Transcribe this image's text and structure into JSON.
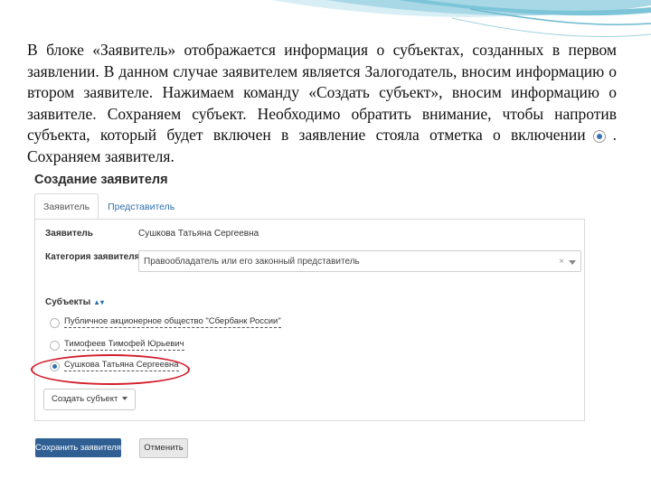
{
  "intro": {
    "text_before_icon": "В блоке «Заявитель» отображается информация о субъектах, созданных в первом заявлении. В данном случае заявителем является Залогодатель, вносим информацию о втором заявителе. Нажимаем команду «Создать субъект», вносим информацию о заявителе. Сохраняем субъект. Необходимо обратить внимание, чтобы напротив субъекта, который будет включен в заявление стояла отметка о включении",
    "text_after_icon": ". Сохраняем заявителя.",
    "icon": "radio-selected-icon"
  },
  "form": {
    "title": "Создание заявителя",
    "tabs": [
      {
        "label": "Заявитель",
        "active": true
      },
      {
        "label": "Представитель",
        "active": false
      }
    ],
    "applicant_label": "Заявитель",
    "applicant_value": "Сушкова Татьяна Сергеевна",
    "category_label": "Категория заявителя",
    "category_value": "Правообладатель или его законный представитель",
    "category_clear": "×",
    "subjects_label": "Субъекты",
    "subjects_sort": "▲▾",
    "subjects": [
      {
        "name": "Публичное акционерное общество \"Сбербанк России\"",
        "selected": false
      },
      {
        "name": "Тимофеев Тимофей Юрьевич",
        "selected": false
      },
      {
        "name": "Сушкова Татьяна Сергеевна",
        "selected": true
      }
    ],
    "create_subject_label": "Создать субъект",
    "save_label": "Сохранить заявителя",
    "cancel_label": "Отменить"
  },
  "colors": {
    "accent": "#2f5f93",
    "link": "#2f6fad",
    "highlight": "#d21f2c",
    "wave": "#7cc4d8"
  }
}
